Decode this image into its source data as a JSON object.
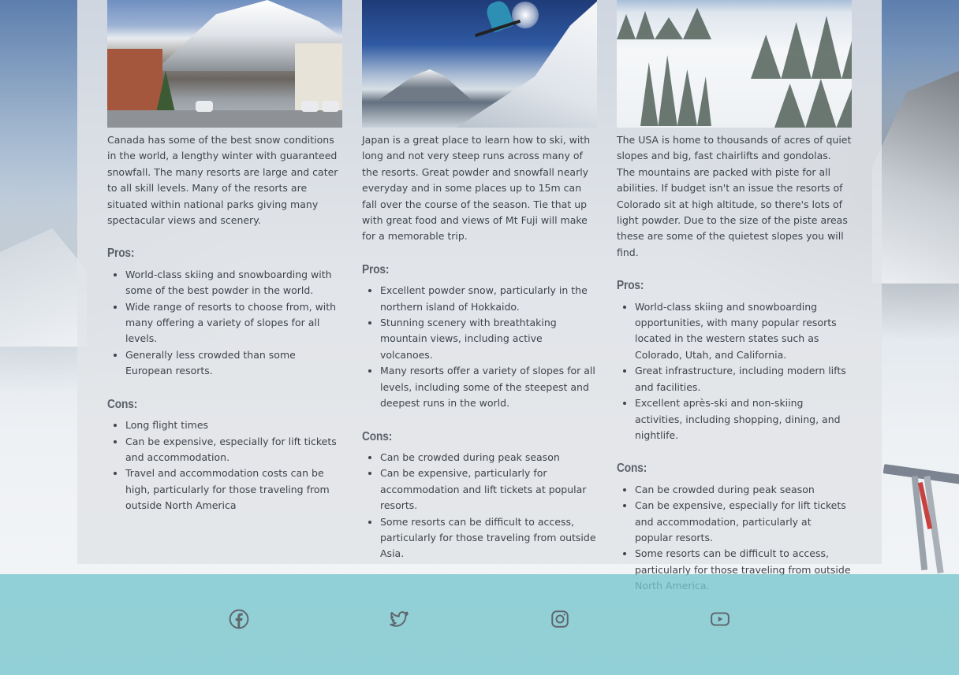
{
  "cards": [
    {
      "photo_alt": "Canadian mountain town",
      "description": "Canada has some of the best snow conditions in the world, a lengthy winter with guaranteed snowfall. The many resorts are large and cater to all skill levels. Many of the resorts are situated within national parks giving many spectacular views and scenery.",
      "pros_heading": "Pros:",
      "pros": [
        "World-class skiing and snowboarding with some of the best powder in the world.",
        "Wide range of resorts to choose from, with many offering a variety of slopes for all levels.",
        "Generally less crowded than some European resorts."
      ],
      "cons_heading": "Cons:",
      "cons": [
        "Long flight times",
        "Can be expensive, especially for lift tickets and accommodation.",
        "Travel and accommodation costs can be high, particularly for those traveling from outside North America"
      ]
    },
    {
      "photo_alt": "Skier jumping in Japan",
      "description": "Japan is a great place to learn how to ski, with long and not very steep runs across many of the resorts. Great powder and snowfall nearly everyday and in some places up to 15m can fall over the course of the season. Tie that up with great food and views of Mt Fuji will make for a memorable trip.",
      "pros_heading": "Pros:",
      "pros": [
        "Excellent powder snow, particularly in the northern island of Hokkaido.",
        "Stunning scenery with breathtaking mountain views, including active volcanoes.",
        "Many resorts offer a variety of slopes for all levels, including some of the steepest and deepest runs in the world."
      ],
      "cons_heading": "Cons:",
      "cons": [
        "Can be crowded during peak season",
        "Can be expensive, particularly for accommodation and lift tickets at popular resorts.",
        "Some resorts can be difficult to access, particularly for those traveling from outside Asia."
      ]
    },
    {
      "photo_alt": "Snowy ski slopes in the USA",
      "description": "The USA is home to thousands of acres of quiet slopes and big, fast chairlifts and gondolas. The mountains are packed with piste for all abilities. If budget isn't an issue the resorts of Colorado sit at high altitude, so there's lots of light powder. Due to the size of the piste areas these are some of the quietest slopes you will find.",
      "pros_heading": "Pros:",
      "pros": [
        "World-class skiing and snowboarding opportunities, with many popular resorts located in the western states such as Colorado, Utah, and California.",
        "Great infrastructure, including modern lifts and facilities.",
        "Excellent après-ski and non-skiing activities, including shopping, dining, and nightlife."
      ],
      "cons_heading": "Cons:",
      "cons": [
        "Can be crowded during peak season",
        "Can be expensive, especially for lift tickets and accommodation, particularly at popular resorts.",
        "Some resorts can be difficult to access, particularly for those traveling from outside North America."
      ]
    }
  ],
  "footer": {
    "social": [
      {
        "icon": "facebook-icon"
      },
      {
        "icon": "twitter-icon"
      },
      {
        "icon": "instagram-icon"
      },
      {
        "icon": "youtube-icon"
      }
    ]
  },
  "colors": {
    "footer_bg": "#76c5cd",
    "panel_bg": "#e2e4e8",
    "text": "#3f444b",
    "heading": "#5b6068",
    "icon": "#5f656d"
  }
}
